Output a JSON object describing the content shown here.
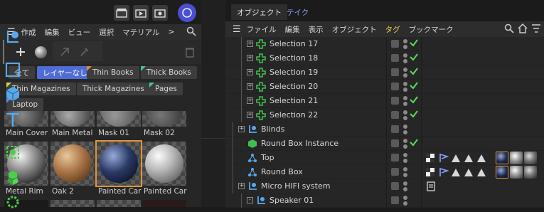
{
  "left_panel": {
    "menu": [
      "作成",
      "編集",
      "ビュー",
      "選択",
      "マテリアル",
      ">"
    ],
    "filter_chips": [
      {
        "label": "全て",
        "selected": false,
        "corner": ""
      },
      {
        "label": "レイヤーなし",
        "selected": true,
        "corner": ""
      },
      {
        "label": "Thin Books",
        "selected": false,
        "corner": "orange"
      },
      {
        "label": "Thick Books",
        "selected": false,
        "corner": "teal"
      },
      {
        "label": "Thin Magazines",
        "selected": false,
        "corner": "yellow"
      },
      {
        "label": "Thick Magazines",
        "selected": false,
        "corner": ""
      },
      {
        "label": "Pages",
        "selected": false,
        "corner": "teal"
      },
      {
        "label": "Laptop",
        "selected": false,
        "corner": "blue"
      }
    ],
    "materials_row1": [
      "Main Cover",
      "Main Metal",
      "Mask 01",
      "Mask 02"
    ],
    "materials_row2": [
      "Metal Rim",
      "Oak 2",
      "Painted Car",
      "Painted Car"
    ],
    "selected_material_index": 2
  },
  "right_panel": {
    "tabs": [
      "オブジェクト",
      "テイク"
    ],
    "menu": [
      "ファイル",
      "編集",
      "表示",
      "オブジェクト",
      "タグ",
      "ブックマーク"
    ],
    "rows": [
      {
        "name": "Selection 17",
        "indent": 1,
        "icon": "selection-icon",
        "expand": "+",
        "check": true
      },
      {
        "name": "Selection 18",
        "indent": 1,
        "icon": "selection-icon",
        "expand": "+",
        "check": true
      },
      {
        "name": "Selection 19",
        "indent": 1,
        "icon": "selection-icon",
        "expand": "+",
        "check": true
      },
      {
        "name": "Selection 20",
        "indent": 1,
        "icon": "selection-icon",
        "expand": "+",
        "check": true
      },
      {
        "name": "Selection 21",
        "indent": 1,
        "icon": "selection-icon",
        "expand": "+",
        "check": true
      },
      {
        "name": "Selection 22",
        "indent": 1,
        "icon": "selection-icon",
        "expand": "+",
        "check": true
      },
      {
        "name": "Blinds",
        "indent": 0,
        "icon": "null-icon",
        "expand": "+",
        "check": false
      },
      {
        "name": "Round Box Instance",
        "indent": 0,
        "icon": "instance-icon",
        "expand": "",
        "check": true
      },
      {
        "name": "Top",
        "indent": 0,
        "icon": "primitive-icon",
        "expand": "",
        "check": false,
        "tags": true
      },
      {
        "name": "Round Box",
        "indent": 0,
        "icon": "primitive-icon",
        "expand": "",
        "check": false,
        "tags": true
      },
      {
        "name": "Micro HIFI system",
        "indent": 0,
        "icon": "null-icon",
        "expand": "+",
        "check": false,
        "note": true
      },
      {
        "name": "Speaker 01",
        "indent": 1,
        "icon": "null-icon",
        "expand": "-",
        "check": false
      }
    ]
  },
  "colors": {
    "accent_blue": "#4f6cd6",
    "check_green": "#5fd85f",
    "selection_green": "#3fbf4f",
    "tab_highlight": "#8aa0ff",
    "tag_yellow": "#d8d04a",
    "selected_orange": "#e0963a"
  }
}
